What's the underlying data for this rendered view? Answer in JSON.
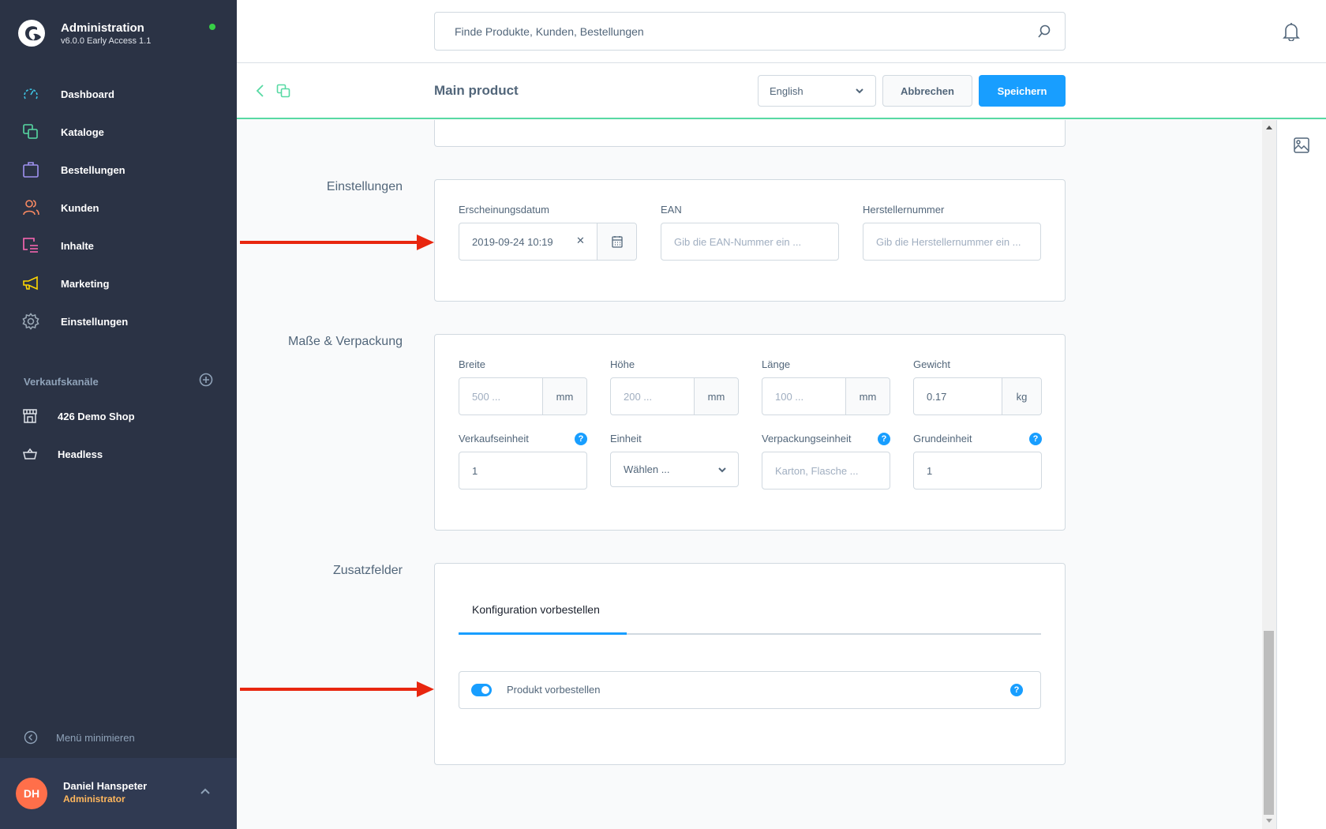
{
  "app": {
    "title": "Administration",
    "version": "v6.0.0 Early Access 1.1",
    "status_color": "#37d046"
  },
  "sidebar": {
    "items": [
      {
        "label": "Dashboard",
        "icon": "dashboard-icon",
        "color": "#3ec6e6"
      },
      {
        "label": "Kataloge",
        "icon": "catalog-icon",
        "color": "#57d9a3"
      },
      {
        "label": "Bestellungen",
        "icon": "orders-icon",
        "color": "#a092f0"
      },
      {
        "label": "Kunden",
        "icon": "customers-icon",
        "color": "#f88962"
      },
      {
        "label": "Inhalte",
        "icon": "content-icon",
        "color": "#ff68b4"
      },
      {
        "label": "Marketing",
        "icon": "marketing-icon",
        "color": "#ffd700"
      },
      {
        "label": "Einstellungen",
        "icon": "settings-icon",
        "color": "#9aa8b5"
      }
    ],
    "channels_label": "Verkaufskanäle",
    "channels": [
      {
        "label": "426 Demo Shop",
        "icon": "storefront-icon"
      },
      {
        "label": "Headless",
        "icon": "basket-icon"
      }
    ],
    "minimize_label": "Menü minimieren",
    "user": {
      "initials": "DH",
      "name": "Daniel Hanspeter",
      "role": "Administrator"
    }
  },
  "topbar": {
    "search_placeholder": "Finde Produkte, Kunden, Bestellungen"
  },
  "toolbar": {
    "title": "Main product",
    "language": "English",
    "cancel_label": "Abbrechen",
    "save_label": "Speichern",
    "accent_color": "#189eff"
  },
  "sections": {
    "settings": {
      "label": "Einstellungen",
      "release_date_label": "Erscheinungsdatum",
      "release_date_value": "2019-09-24 10:19",
      "clear_glyph": "✕",
      "ean_label": "EAN",
      "ean_placeholder": "Gib die EAN-Nummer ein ...",
      "mpn_label": "Herstellernummer",
      "mpn_placeholder": "Gib die Herstellernummer ein ..."
    },
    "dimensions": {
      "label": "Maße & Verpackung",
      "width_label": "Breite",
      "width_placeholder": "500 ...",
      "width_unit": "mm",
      "height_label": "Höhe",
      "height_placeholder": "200 ...",
      "height_unit": "mm",
      "length_label": "Länge",
      "length_placeholder": "100 ...",
      "length_unit": "mm",
      "weight_label": "Gewicht",
      "weight_value": "0.17",
      "weight_unit": "kg",
      "purchase_unit_label": "Verkaufseinheit",
      "purchase_unit_value": "1",
      "unit_label": "Einheit",
      "unit_placeholder": "Wählen ...",
      "pack_unit_label": "Verpackungseinheit",
      "pack_unit_placeholder": "Karton, Flasche ...",
      "reference_unit_label": "Grundeinheit",
      "reference_unit_value": "1",
      "help_glyph": "?"
    },
    "custom_fields": {
      "label": "Zusatzfelder",
      "tab_label": "Konfiguration vorbestellen",
      "toggle_label": "Produkt vorbestellen",
      "toggle_on": true
    }
  }
}
